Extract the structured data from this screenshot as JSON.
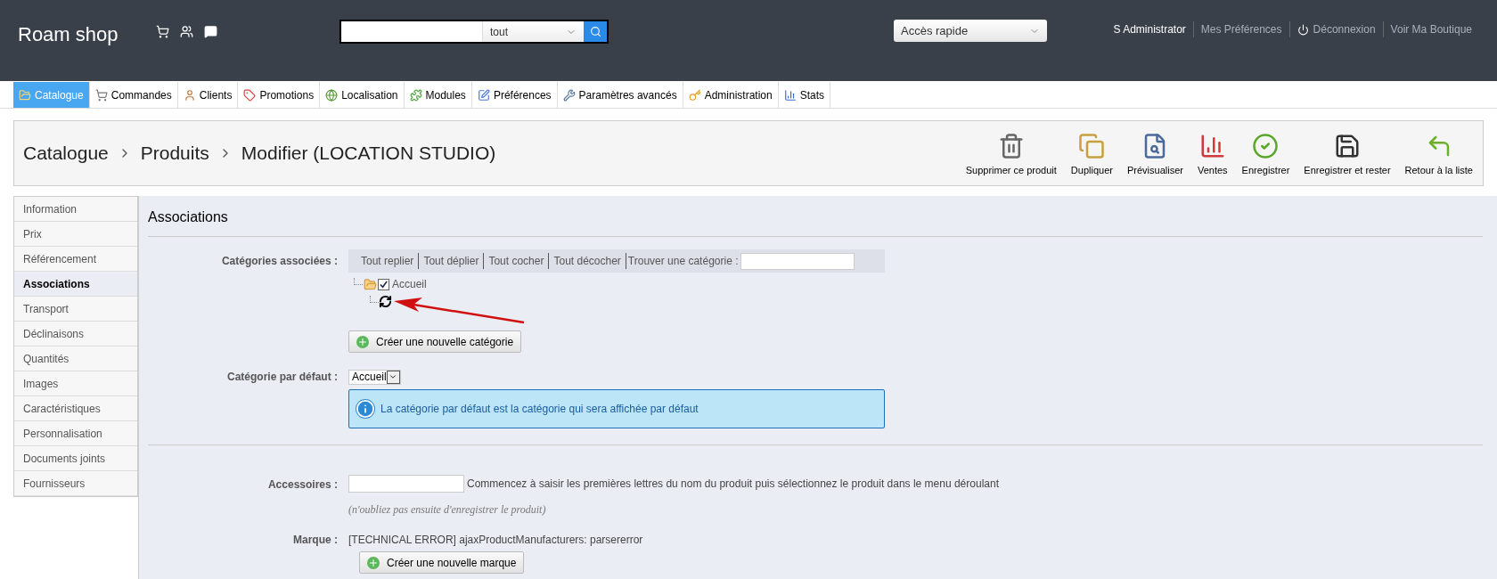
{
  "header": {
    "shop_name": "Roam shop",
    "search_scope": "tout",
    "quick_access": "Accès rapide",
    "user_links": [
      "S Administrator",
      "Mes Préférences",
      "Déconnexion",
      "Voir Ma Boutique"
    ]
  },
  "nav_tabs": [
    {
      "label": "Catalogue",
      "selected": true
    },
    {
      "label": "Commandes",
      "selected": false
    },
    {
      "label": "Clients",
      "selected": false
    },
    {
      "label": "Promotions",
      "selected": false
    },
    {
      "label": "Localisation",
      "selected": false
    },
    {
      "label": "Modules",
      "selected": false
    },
    {
      "label": "Préférences",
      "selected": false
    },
    {
      "label": "Paramètres avancés",
      "selected": false
    },
    {
      "label": "Administration",
      "selected": false
    },
    {
      "label": "Stats",
      "selected": false
    }
  ],
  "breadcrumb": [
    "Catalogue",
    "Produits",
    "Modifier (LOCATION STUDIO)"
  ],
  "toolbar": [
    "Supprimer ce produit",
    "Dupliquer",
    "Prévisualiser",
    "Ventes",
    "Enregistrer",
    "Enregistrer et rester",
    "Retour à la liste"
  ],
  "side_tabs": [
    {
      "label": "Information",
      "selected": false
    },
    {
      "label": "Prix",
      "selected": false
    },
    {
      "label": "Référencement",
      "selected": false
    },
    {
      "label": "Associations",
      "selected": true
    },
    {
      "label": "Transport",
      "selected": false
    },
    {
      "label": "Déclinaisons",
      "selected": false
    },
    {
      "label": "Quantités",
      "selected": false
    },
    {
      "label": "Images",
      "selected": false
    },
    {
      "label": "Caractéristiques",
      "selected": false
    },
    {
      "label": "Personnalisation",
      "selected": false
    },
    {
      "label": "Documents joints",
      "selected": false
    },
    {
      "label": "Fournisseurs",
      "selected": false
    }
  ],
  "section_title": "Associations",
  "categories": {
    "label": "Catégories associées :",
    "tree_actions": [
      "Tout replier",
      "Tout déplier",
      "Tout cocher",
      "Tout décocher"
    ],
    "find_label": "Trouver une catégorie :",
    "tree": [
      {
        "label": "Accueil",
        "checked": true,
        "loading": true
      }
    ],
    "create_button": "Créer une nouvelle catégorie"
  },
  "default_category": {
    "label": "Catégorie par défaut :",
    "value": "Accueil",
    "info": "La catégorie par défaut est la catégorie qui sera affichée par défaut"
  },
  "accessories": {
    "label": "Accessoires :",
    "hint": "Commencez à saisir les premières lettres du nom du produit puis sélectionnez le produit dans le menu déroulant",
    "note": "(n'oubliez pas ensuite d'enregistrer le produit)"
  },
  "brand": {
    "label": "Marque :",
    "error": "[TECHNICAL ERROR] ajaxProductManufacturers: parsererror",
    "create_button": "Créer une nouvelle marque"
  }
}
